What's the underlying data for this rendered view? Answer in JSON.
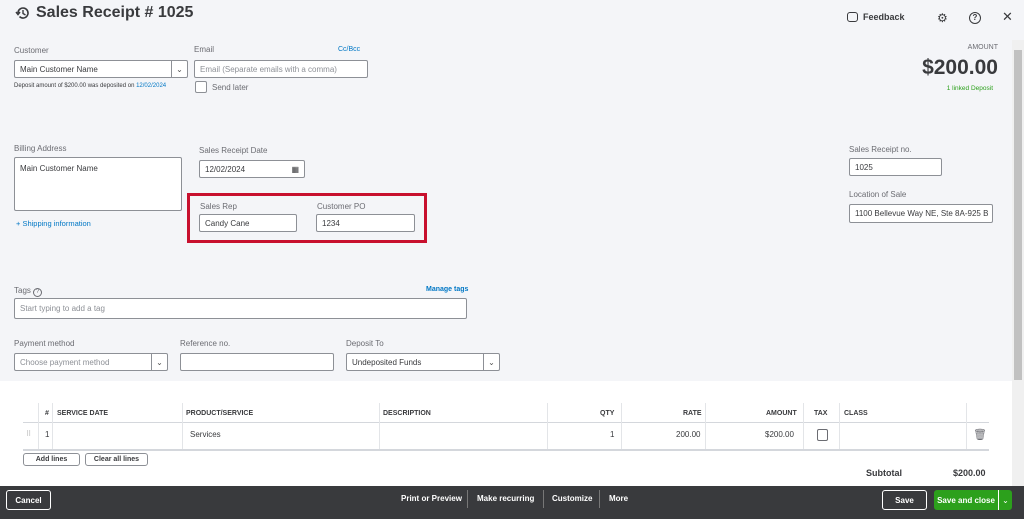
{
  "header": {
    "title": "Sales Receipt # 1025",
    "feedback": "Feedback"
  },
  "customer": {
    "label": "Customer",
    "value": "Main Customer Name",
    "deposit_note": "Deposit amount of $200.00 was deposited on",
    "deposit_date": "12/02/2024"
  },
  "email": {
    "label": "Email",
    "cc_bcc": "Cc/Bcc",
    "placeholder": "Email (Separate emails with a comma)",
    "send_later": "Send later"
  },
  "amount": {
    "label": "AMOUNT",
    "value": "$200.00",
    "linked": "1 linked Deposit"
  },
  "billing": {
    "label": "Billing Address",
    "value": "Main Customer Name",
    "shipping": "+ Shipping information"
  },
  "date": {
    "label": "Sales Receipt Date",
    "value": "12/02/2024"
  },
  "sales_rep": {
    "label": "Sales Rep",
    "value": "Candy Cane"
  },
  "customer_po": {
    "label": "Customer PO",
    "value": "1234"
  },
  "receipt_no": {
    "label": "Sales Receipt no.",
    "value": "1025"
  },
  "location": {
    "label": "Location of Sale",
    "value": "1100 Bellevue Way NE, Ste 8A-925 B"
  },
  "tags": {
    "label": "Tags",
    "manage": "Manage tags",
    "placeholder": "Start typing to add a tag"
  },
  "payment": {
    "label": "Payment method",
    "placeholder": "Choose payment method"
  },
  "reference": {
    "label": "Reference no.",
    "value": ""
  },
  "deposit_to": {
    "label": "Deposit To",
    "value": "Undeposited Funds"
  },
  "table": {
    "headers": [
      "#",
      "SERVICE DATE",
      "PRODUCT/SERVICE",
      "DESCRIPTION",
      "QTY",
      "RATE",
      "AMOUNT",
      "TAX",
      "CLASS"
    ],
    "rows": [
      {
        "num": "1",
        "service_date": "",
        "product": "Services",
        "description": "",
        "qty": "1",
        "rate": "200.00",
        "amount": "$200.00",
        "tax": false,
        "class": ""
      }
    ],
    "add_lines": "Add lines",
    "clear_lines": "Clear all lines",
    "subtotal_label": "Subtotal",
    "subtotal": "$200.00"
  },
  "footer": {
    "cancel": "Cancel",
    "print": "Print or Preview",
    "recurring": "Make recurring",
    "customize": "Customize",
    "more": "More",
    "save": "Save",
    "save_close": "Save and close"
  },
  "colors": {
    "highlight": "#c8102e",
    "primary_green": "#2ca01c",
    "link": "#0077c5",
    "footer": "#393a3d"
  }
}
